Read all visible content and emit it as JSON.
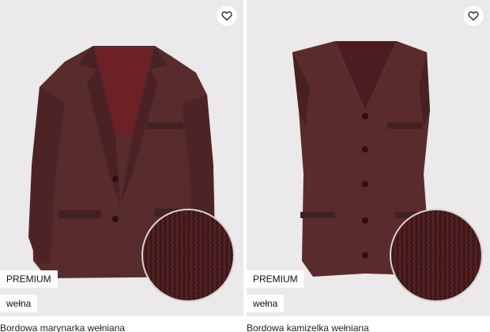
{
  "products": [
    {
      "badge_premium": "PREMIUM",
      "badge_material": "wełna",
      "title": "Bordowa marynarka wełniana",
      "image_icon": "blazer-image",
      "favorite_icon": "heart-outline-icon"
    },
    {
      "badge_premium": "PREMIUM",
      "badge_material": "wełna",
      "title": "Bordowa kamizelka wełniana",
      "image_icon": "vest-image",
      "favorite_icon": "heart-outline-icon"
    }
  ],
  "colors": {
    "background": "#ebe9e9",
    "fabric": "#5a2a2c",
    "fabric_dark": "#3e1a1c",
    "badge_bg": "#ffffff"
  }
}
